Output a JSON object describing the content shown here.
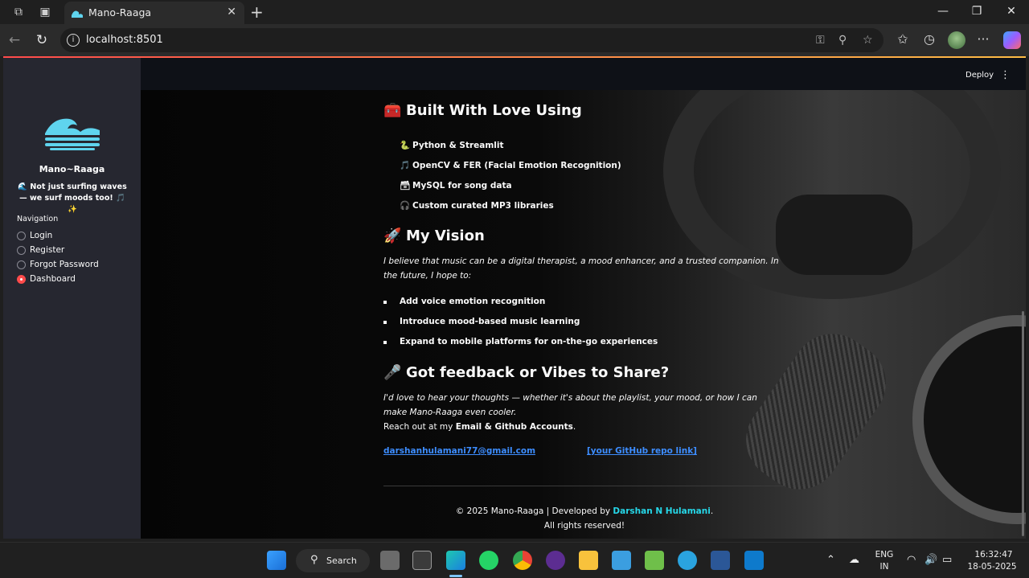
{
  "browser": {
    "tab_title": "Mano-Raaga",
    "url": "localhost:8501"
  },
  "header": {
    "deploy_label": "Deploy",
    "menu_icon": "⋮"
  },
  "sidebar": {
    "app_title": "Mano~Raaga",
    "tagline": "🌊 Not just surfing waves — we surf moods too! 🎵 ✨",
    "nav_label": "Navigation",
    "nav_items": [
      {
        "label": "Login",
        "selected": false
      },
      {
        "label": "Register",
        "selected": false
      },
      {
        "label": "Forgot Password",
        "selected": false
      },
      {
        "label": "Dashboard",
        "selected": true
      }
    ]
  },
  "main": {
    "built_heading": {
      "emoji": "🧰",
      "text": "Built With Love Using"
    },
    "built_items": [
      {
        "icon": "🐍",
        "text": "Python & Streamlit"
      },
      {
        "icon": "🎵",
        "text": "OpenCV & FER (Facial Emotion Recognition)"
      },
      {
        "icon": "🗃",
        "text": "MySQL for song data"
      },
      {
        "icon": "🎧",
        "text": "Custom curated MP3 libraries"
      }
    ],
    "vision_heading": {
      "emoji": "🚀",
      "text": "My Vision"
    },
    "vision_text": "I believe that music can be a digital therapist, a mood enhancer, and a trusted companion. In the future, I hope to:",
    "vision_items": [
      "Add voice emotion recognition",
      "Introduce mood-based music learning",
      "Expand to mobile platforms for on-the-go experiences"
    ],
    "feedback_heading": {
      "emoji": "🎤",
      "text": "Got feedback or Vibes to Share?"
    },
    "feedback_text": "I'd love to hear your thoughts — whether it's about the playlist, your mood, or how I can make Mano-Raaga even cooler.",
    "reach_prefix": "Reach out at my ",
    "reach_bold": "Email & Github Accounts",
    "reach_suffix": ".",
    "email_link": "darshanhulamani77@gmail.com",
    "github_link": "[your GitHub repo link]",
    "footer_prefix": "© 2025 Mano-Raaga | Developed by ",
    "footer_name": "Darshan N Hulamani",
    "footer_suffix": ".",
    "footer_rights": "All rights reserved!"
  },
  "taskbar": {
    "search_label": "Search",
    "lang_top": "ENG",
    "lang_bottom": "IN",
    "time": "16:32:47",
    "date": "18-05-2025"
  },
  "colors": {
    "accent": "#ff4b4b",
    "link": "#3d8dff",
    "dev_name": "#26d7e8",
    "sidebar_bg": "#262730",
    "logo_wave": "#5fd4ee"
  }
}
